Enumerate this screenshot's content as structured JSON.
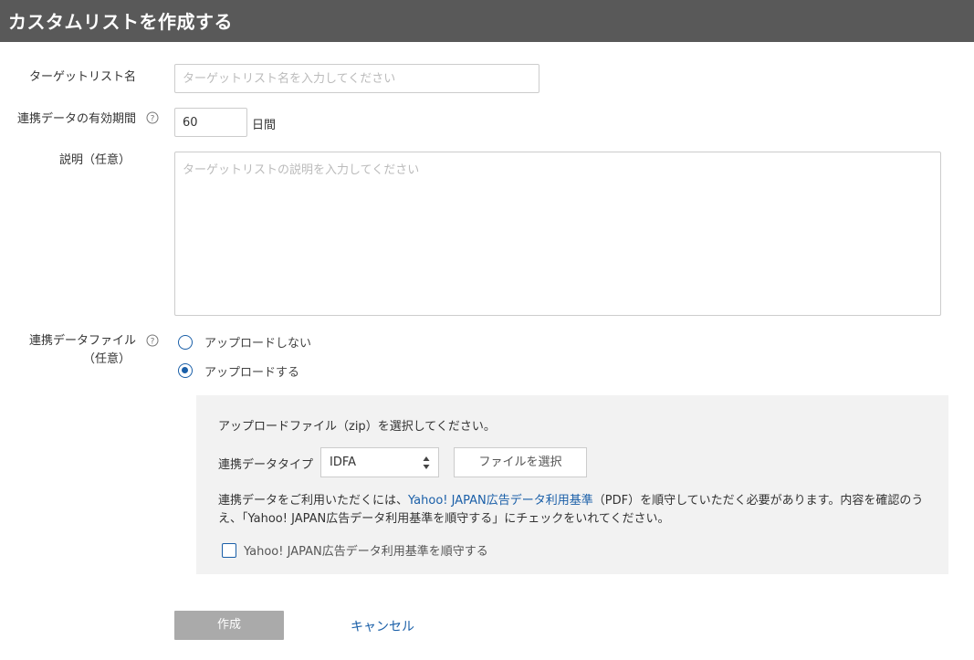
{
  "header": {
    "title": "カスタムリストを作成する"
  },
  "form": {
    "target_name": {
      "label": "ターゲットリスト名",
      "placeholder": "ターゲットリスト名を入力してください",
      "value": ""
    },
    "validity": {
      "label": "連携データの有効期間",
      "value": "60",
      "unit": "日間",
      "help_icon": "question-circle-icon"
    },
    "description": {
      "label": "説明（任意）",
      "placeholder": "ターゲットリストの説明を入力してください",
      "value": ""
    },
    "data_file": {
      "label_line1": "連携データファイル",
      "label_line2": "（任意）",
      "help_icon": "question-circle-icon",
      "options": [
        {
          "label": "アップロードしない",
          "checked": false
        },
        {
          "label": "アップロードする",
          "checked": true
        }
      ]
    }
  },
  "upload_panel": {
    "instruction": "アップロードファイル（zip）を選択してください。",
    "type_label": "連携データタイプ",
    "type_selected": "IDFA",
    "file_button": "ファイルを選択",
    "notice_prefix": "連携データをご利用いただくには、",
    "notice_link": "Yahoo! JAPAN広告データ利用基準",
    "notice_suffix": "（PDF）を順守していただく必要があります。内容を確認のう",
    "notice_line2": "え、「Yahoo! JAPAN広告データ利用基準を順守する」にチェックをいれてください。",
    "agree_label": "Yahoo! JAPAN広告データ利用基準を順守する",
    "agree_checked": false
  },
  "actions": {
    "create": "作成",
    "cancel": "キャンセル"
  },
  "colors": {
    "header_bg": "#595959",
    "accent": "#1a5fa8",
    "panel_bg": "#f2f2f2",
    "disabled_button": "#aaaaaa"
  }
}
